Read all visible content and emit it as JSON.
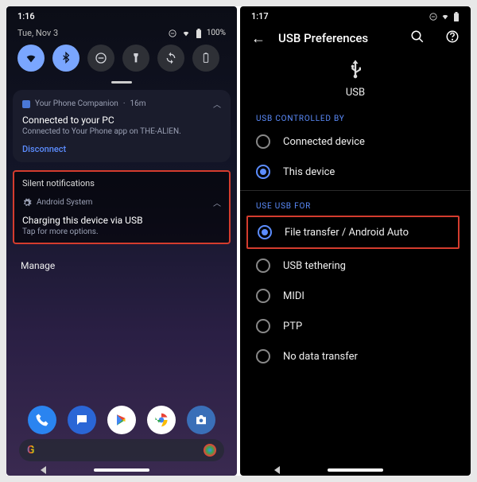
{
  "left": {
    "status_time": "1:16",
    "date": "Tue, Nov 3",
    "battery_text": "100%",
    "notif1": {
      "app": "Your Phone Companion",
      "age": "16m",
      "title": "Connected to your PC",
      "sub": "Connected to Your Phone app on THE-ALIEN.",
      "action": "Disconnect"
    },
    "silent_title": "Silent notifications",
    "notif2": {
      "app": "Android System",
      "title": "Charging this device via USB",
      "sub": "Tap for more options."
    },
    "manage": "Manage"
  },
  "right": {
    "status_time": "1:17",
    "appbar_title": "USB Preferences",
    "hero_label": "USB",
    "section1": "USB CONTROLLED BY",
    "opt_connected": "Connected device",
    "opt_this": "This device",
    "section2": "USE USB FOR",
    "opt_file": "File transfer / Android Auto",
    "opt_tether": "USB tethering",
    "opt_midi": "MIDI",
    "opt_ptp": "PTP",
    "opt_none": "No data transfer"
  }
}
